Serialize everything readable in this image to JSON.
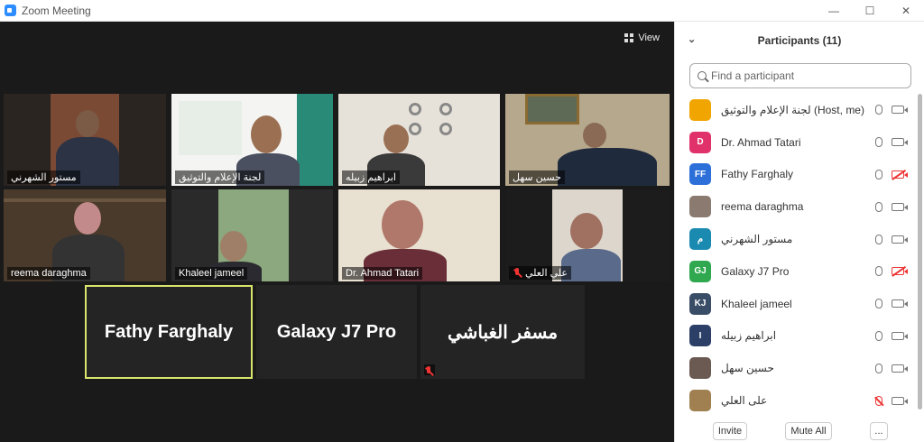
{
  "window": {
    "title": "Zoom Meeting",
    "minimize": "—",
    "maximize": "☐",
    "close": "✕"
  },
  "video": {
    "view_label": "View",
    "tiles": [
      {
        "label": "مستور الشهرني"
      },
      {
        "label": "لجنة الإعلام والتوثيق"
      },
      {
        "label": "ابراهيم زبيله"
      },
      {
        "label": "حسين سهل"
      },
      {
        "label": "reema daraghma"
      },
      {
        "label": "Khaleel jameel"
      },
      {
        "label": "Dr. Ahmad Tatari"
      },
      {
        "label": "علي العلي"
      }
    ],
    "name_tiles": [
      {
        "name": "Fathy Farghaly"
      },
      {
        "name": "Galaxy J7 Pro"
      },
      {
        "name": "مسفر الغباشي"
      }
    ]
  },
  "participants": {
    "title": "Participants (11)",
    "search_placeholder": "Find a participant",
    "list": [
      {
        "name": "لجنة الإعلام والتوثيق (Host, me)",
        "initials": "",
        "color": "#f0a500",
        "mic_off": false,
        "cam_off": false
      },
      {
        "name": "Dr. Ahmad Tatari",
        "initials": "D",
        "color": "#e0316b",
        "mic_off": false,
        "cam_off": false
      },
      {
        "name": "Fathy Farghaly",
        "initials": "FF",
        "color": "#2d6fd8",
        "mic_off": false,
        "cam_off": true
      },
      {
        "name": "reema daraghma",
        "initials": "",
        "color": "#8a7a70",
        "mic_off": false,
        "cam_off": false
      },
      {
        "name": "مستور الشهرني",
        "initials": "م",
        "color": "#1b8ab0",
        "mic_off": false,
        "cam_off": false
      },
      {
        "name": "Galaxy J7 Pro",
        "initials": "GJ",
        "color": "#2fa84f",
        "mic_off": false,
        "cam_off": true
      },
      {
        "name": "Khaleel jameel",
        "initials": "KJ",
        "color": "#3a4d66",
        "mic_off": false,
        "cam_off": false
      },
      {
        "name": "ابراهيم زبيله",
        "initials": "I",
        "color": "#2c3f66",
        "mic_off": false,
        "cam_off": false
      },
      {
        "name": "حسين سهل",
        "initials": "",
        "color": "#6b5a52",
        "mic_off": false,
        "cam_off": false
      },
      {
        "name": "على العلي",
        "initials": "",
        "color": "#a08050",
        "mic_off": true,
        "cam_off": false
      }
    ],
    "invite_label": "Invite",
    "mute_all_label": "Mute All",
    "more_label": "..."
  },
  "colors": {
    "active_speaker_border": "#d8e46c",
    "zoom_blue": "#2d8cff",
    "muted_red": "#e33333"
  }
}
